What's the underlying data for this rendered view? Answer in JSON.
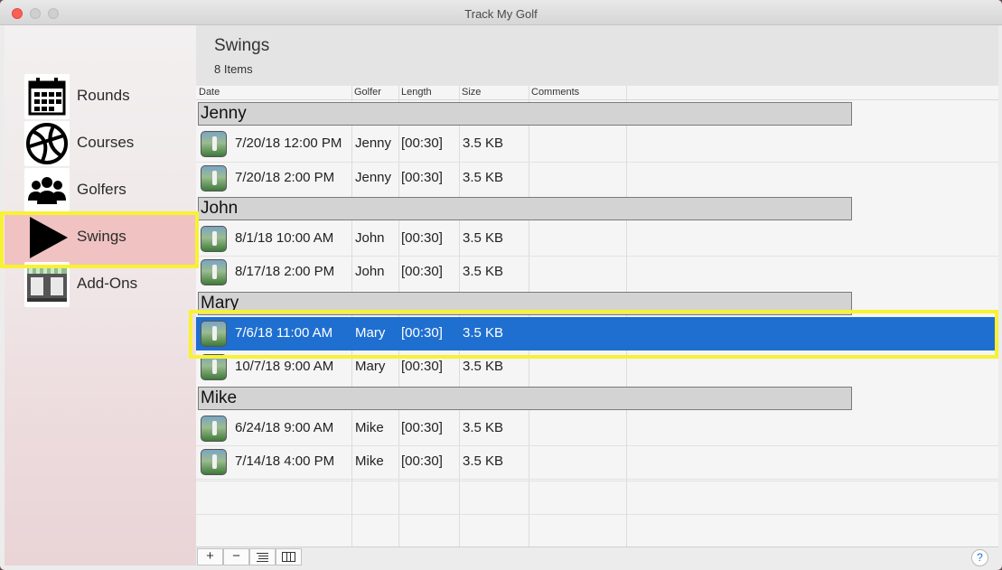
{
  "window": {
    "title": "Track My Golf"
  },
  "sidebar": {
    "items": [
      {
        "label": "Rounds",
        "icon": "calendar-icon"
      },
      {
        "label": "Courses",
        "icon": "globe-icon"
      },
      {
        "label": "Golfers",
        "icon": "people-icon"
      },
      {
        "label": "Swings",
        "icon": "play-icon",
        "selected": true
      },
      {
        "label": "Add-Ons",
        "icon": "storefront-icon"
      }
    ]
  },
  "header": {
    "title": "Swings",
    "count": "8 Items"
  },
  "table": {
    "columns": [
      "Date",
      "Golfer",
      "Length",
      "Size",
      "Comments"
    ],
    "groups": [
      {
        "name": "Jenny",
        "rows": [
          {
            "date": "7/20/18 12:00 PM",
            "golfer": "Jenny",
            "length": "[00:30]",
            "size": "3.5 KB"
          },
          {
            "date": "7/20/18 2:00 PM",
            "golfer": "Jenny",
            "length": "[00:30]",
            "size": "3.5 KB"
          }
        ]
      },
      {
        "name": "John",
        "rows": [
          {
            "date": "8/1/18 10:00 AM",
            "golfer": "John",
            "length": "[00:30]",
            "size": "3.5 KB"
          },
          {
            "date": "8/17/18 2:00 PM",
            "golfer": "John",
            "length": "[00:30]",
            "size": "3.5 KB"
          }
        ]
      },
      {
        "name": "Mary",
        "rows": [
          {
            "date": "7/6/18 11:00 AM",
            "golfer": "Mary",
            "length": "[00:30]",
            "size": "3.5 KB",
            "selected": true
          },
          {
            "date": "10/7/18 9:00 AM",
            "golfer": "Mary",
            "length": "[00:30]",
            "size": "3.5 KB"
          }
        ]
      },
      {
        "name": "Mike",
        "rows": [
          {
            "date": "6/24/18 9:00 AM",
            "golfer": "Mike",
            "length": "[00:30]",
            "size": "3.5 KB"
          },
          {
            "date": "7/14/18 4:00 PM",
            "golfer": "Mike",
            "length": "[00:30]",
            "size": "3.5 KB"
          }
        ]
      }
    ]
  },
  "toolbar": {
    "add_label": "+",
    "remove_label": "−",
    "list_icon": "list-view-icon",
    "columns_icon": "column-view-icon",
    "help_label": "?"
  },
  "colors": {
    "selection": "#1f6fd1",
    "sidebar_selection": "#f0c3c2",
    "highlight": "#f8f232"
  }
}
